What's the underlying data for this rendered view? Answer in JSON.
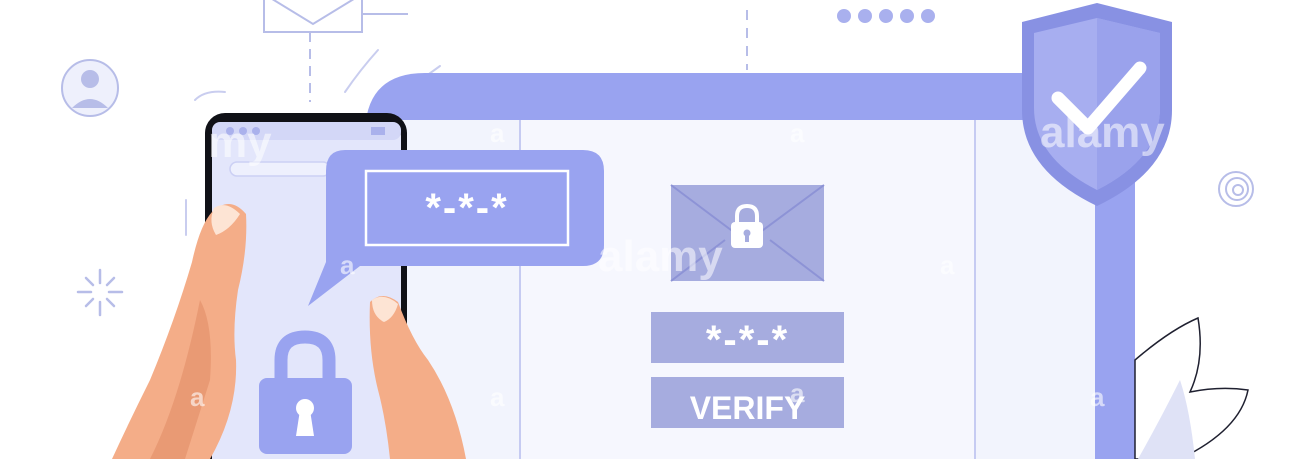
{
  "illustration": {
    "bubble_code": "*-*-*",
    "panel_code": "*-*-*",
    "verify_label": "VERIFY"
  },
  "watermark": {
    "brand": "alamy",
    "brand_partial": "my",
    "mark": "a"
  },
  "icons": [
    "envelope-icon",
    "user-avatar-icon",
    "padlock-icon",
    "envelope-lock-icon",
    "shield-check-icon",
    "spiral-icon",
    "sparkle-icon",
    "leaf-icon",
    "hand-icon",
    "smartphone-icon"
  ],
  "colors": {
    "primary": "#99a3f0",
    "primary_dark": "#8b93e8",
    "panel": "#f2f4fd",
    "button": "#a6acdf",
    "shield": "#8891e3",
    "skin": "#f4ad88",
    "skin_shadow": "#e99a74",
    "outline": "#b7bde8"
  }
}
